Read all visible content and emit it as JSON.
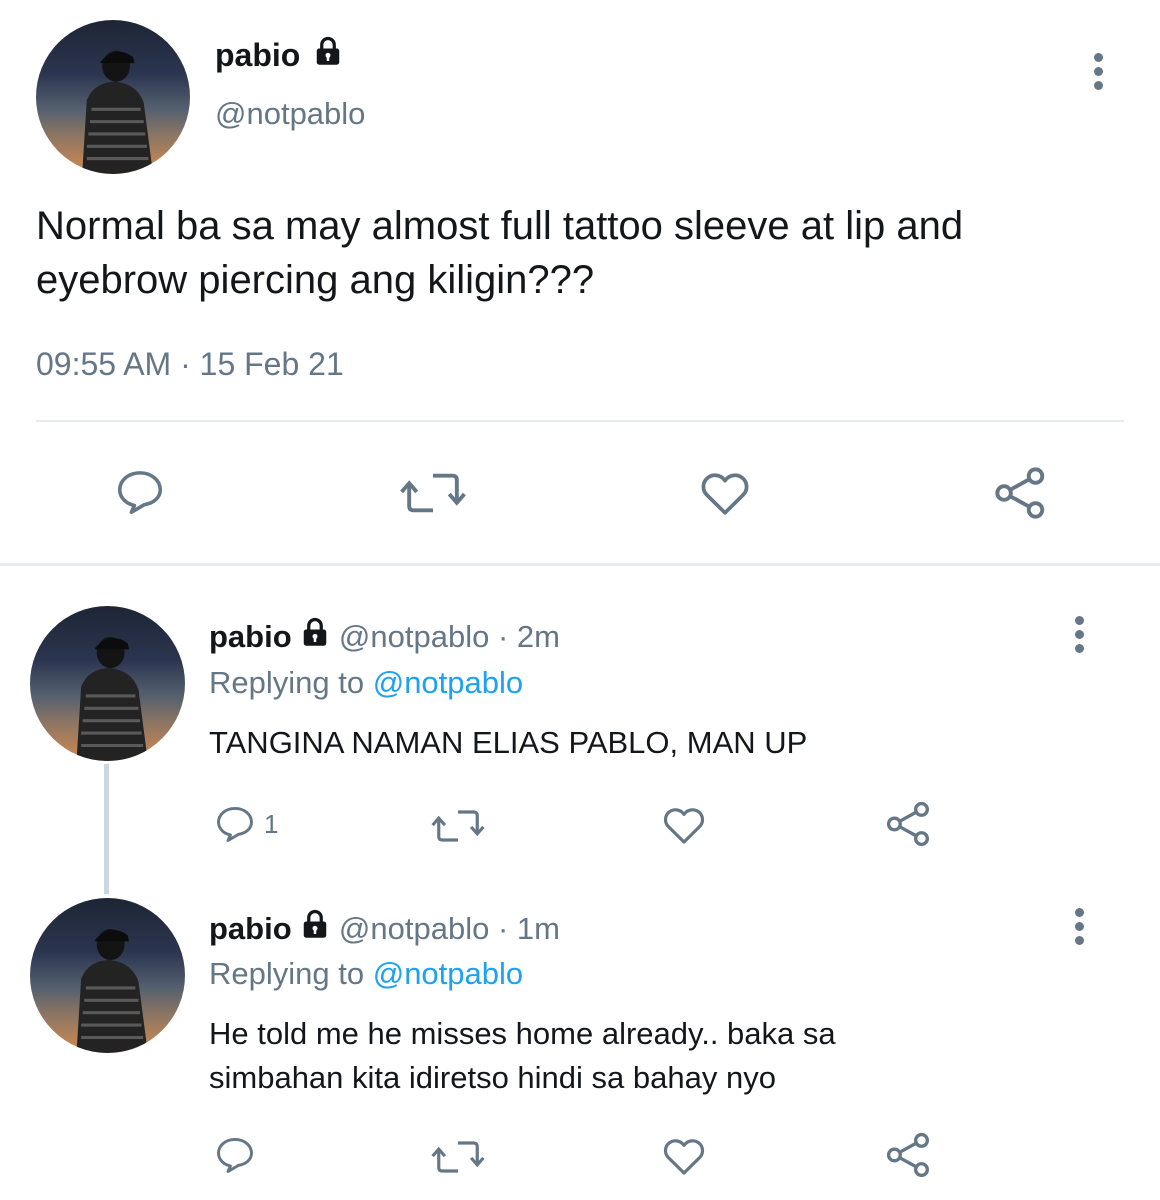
{
  "main_tweet": {
    "display_name": "pabio",
    "handle": "@notpablo",
    "text": "Normal ba sa may almost full tattoo sleeve at lip and eyebrow piercing ang kiligin???",
    "timestamp": "09:55 AM · 15 Feb 21",
    "locked": true,
    "actions": [
      "reply-icon",
      "retweet-icon",
      "like-icon",
      "share-icon"
    ]
  },
  "replies": [
    {
      "display_name": "pabio",
      "meta": "@notpablo · 2m",
      "replying_prefix": "Replying to",
      "replying_handle": "@notpablo",
      "text": "TANGINA NAMAN ELIAS PABLO, MAN UP",
      "reply_count": "1"
    },
    {
      "display_name": "pabio",
      "meta": "@notpablo · 1m",
      "replying_prefix": "Replying to",
      "replying_handle": "@notpablo",
      "text": "He told me he misses home already.. baka sa simbahan kita idiretso hindi sa bahay nyo",
      "reply_count": ""
    }
  ],
  "colors": {
    "text": "#14171a",
    "secondary": "#657786",
    "link": "#1da1f2",
    "divider": "#e6ecf0"
  }
}
